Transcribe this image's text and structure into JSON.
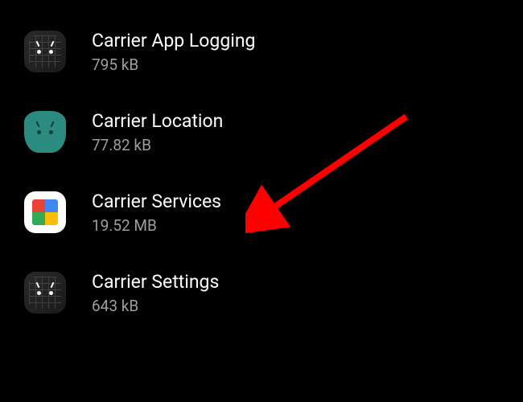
{
  "apps": {
    "items": [
      {
        "name": "Carrier App Logging",
        "size": "795 kB",
        "icon": "android-grid-icon"
      },
      {
        "name": "Carrier Location",
        "size": "77.82 kB",
        "icon": "android-teal-icon"
      },
      {
        "name": "Carrier Services",
        "size": "19.52 MB",
        "icon": "play-services-icon"
      },
      {
        "name": "Carrier Settings",
        "size": "643 kB",
        "icon": "android-grid-icon"
      }
    ]
  },
  "annotation": {
    "arrow_color": "#ff0000",
    "target": "Carrier Services"
  }
}
